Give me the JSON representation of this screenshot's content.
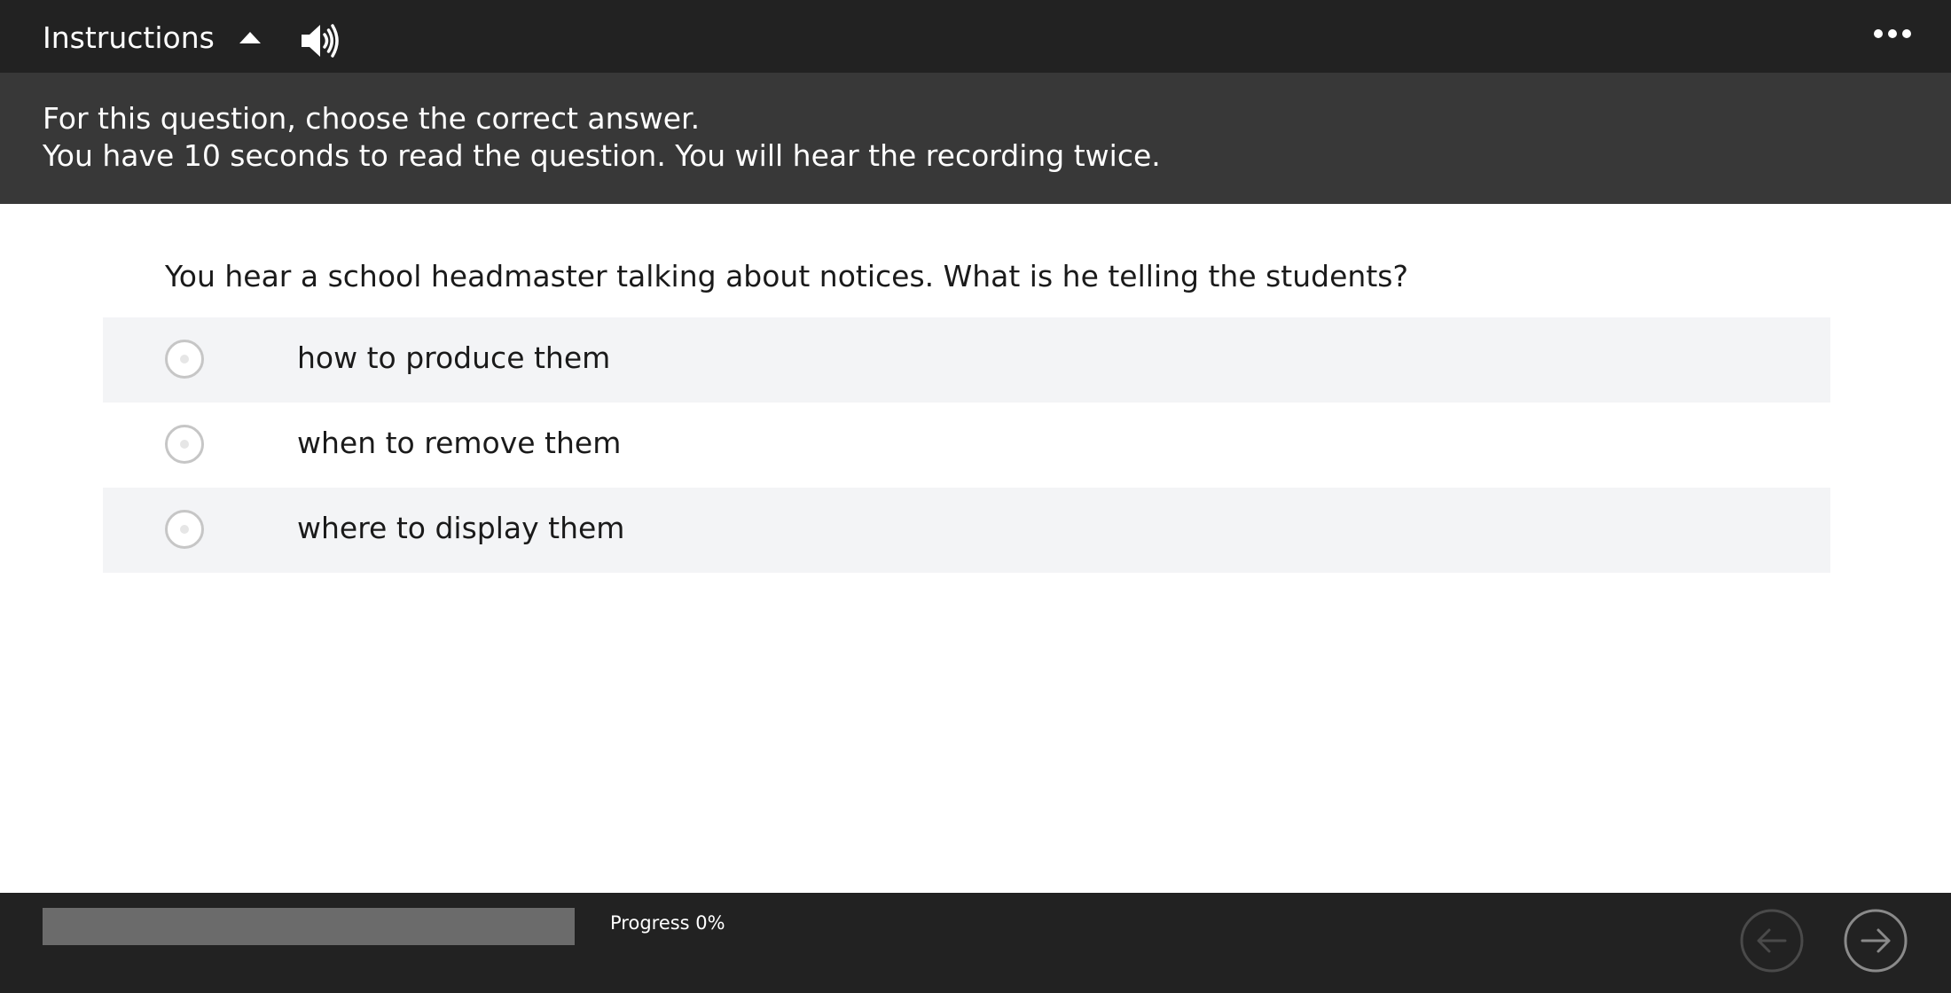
{
  "header": {
    "instructions_label": "Instructions",
    "icons": {
      "toggle": "caret-up-icon",
      "audio": "speaker-icon",
      "menu": "more-options-icon"
    }
  },
  "instructions": {
    "lines": [
      "For this question, choose the correct answer.",
      "You have 10 seconds to read the question. You will hear the recording twice."
    ]
  },
  "question": {
    "text": "You hear a school headmaster talking about notices. What is he telling the students?",
    "options": [
      {
        "label": "how to produce them",
        "selected": false
      },
      {
        "label": "when to remove them",
        "selected": false
      },
      {
        "label": "where to display them",
        "selected": false
      }
    ]
  },
  "footer": {
    "progress_label": "Progress 0%",
    "progress_value": 0,
    "icons": {
      "prev": "arrow-left-icon",
      "next": "arrow-right-icon"
    }
  },
  "colors": {
    "bar_background": "#222222",
    "instructions_background": "#383838",
    "option_shade": "#f3f4f6",
    "progress_track": "#6b6b6b"
  }
}
